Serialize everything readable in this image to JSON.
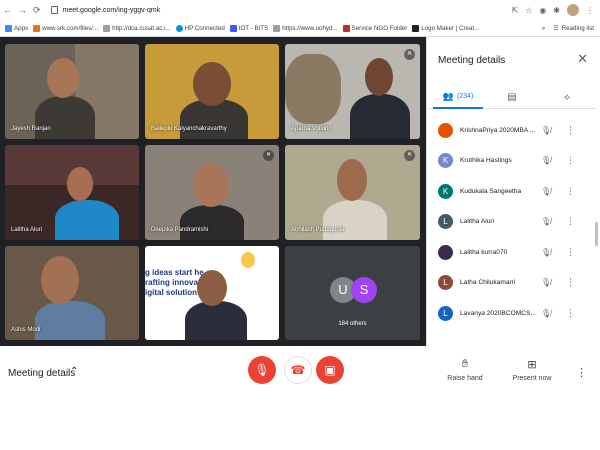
{
  "browser": {
    "url": "meet.google.com/ing-yggv-qmk",
    "bookmarks": [
      {
        "label": "Apps",
        "color": "#4285f4"
      },
      {
        "label": "www.srk.com/files/...",
        "color": "#e8711c"
      },
      {
        "label": "http://dca.cusat.ac.i...",
        "color": "#9aa0a6"
      },
      {
        "label": "HP Connected",
        "color": "#0096d6"
      },
      {
        "label": "IOT - BITS",
        "color": "#3d5afe"
      },
      {
        "label": "https://www.uohyd...",
        "color": "#9aa0a6"
      },
      {
        "label": "Service NGO Folder",
        "color": "#c62828"
      },
      {
        "label": "Logo Maker | Creat...",
        "color": "#222"
      }
    ],
    "more": "»",
    "reading_list": "Reading list"
  },
  "tiles": [
    {
      "name": "Jayesh Ranjan",
      "muted": false,
      "bg": "#6b6356"
    },
    {
      "name": "Balleplu Kalyanchakravarthy",
      "muted": false,
      "bg": "#c79a3a"
    },
    {
      "name": "Aparna Volluru",
      "muted": true,
      "bg": "#b9b7b0"
    },
    {
      "name": "Lalitha Aluri",
      "muted": false,
      "bg": "#5a3a38"
    },
    {
      "name": "Deepika Pandramishi",
      "muted": true,
      "bg": "#8a8178"
    },
    {
      "name": "Abhilash Puttagunta",
      "muted": true,
      "bg": "#b1a890"
    },
    {
      "name": "Ashis Modi",
      "muted": false,
      "bg": "#6a5948"
    },
    {
      "name": "",
      "muted": false,
      "bg": "#ffffff",
      "slide_text": "g ideas start he\nrafting innovat\nigital solution"
    },
    {
      "name": "",
      "muted": false,
      "bg": "#3c4043"
    }
  ],
  "others": {
    "label": "184 others",
    "u": "U",
    "s": "S"
  },
  "panel": {
    "title": "Meeting details",
    "people_count": "(234)",
    "participants": [
      {
        "name": "KrishnaPriya 2020MBA ...",
        "initial": "",
        "color": "#e65100"
      },
      {
        "name": "Kruthika Hastings",
        "initial": "K",
        "color": "#7986cb"
      },
      {
        "name": "Kudukala Sangeetha",
        "initial": "K",
        "color": "#00796b"
      },
      {
        "name": "Lalitha Aluri",
        "initial": "L",
        "color": "#455a64"
      },
      {
        "name": "Lalitha kurra070",
        "initial": "",
        "color": "#3c2b4a"
      },
      {
        "name": "Latha Chilukamarri",
        "initial": "L",
        "color": "#8d4a3a"
      },
      {
        "name": "Lavanya 2020BCOMCS...",
        "initial": "L",
        "color": "#1565c0"
      }
    ]
  },
  "bottom": {
    "meeting_details": "Meeting details",
    "raise_hand": "Raise hand",
    "present_now": "Present now"
  }
}
